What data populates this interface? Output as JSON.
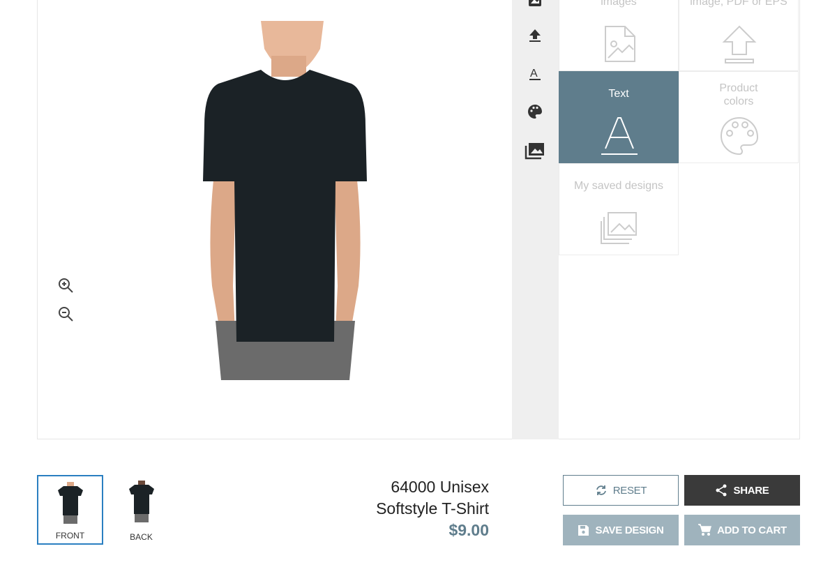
{
  "tiles": [
    {
      "label": "images",
      "icon": "image-file-icon"
    },
    {
      "label": "image, PDF or EPS",
      "icon": "upload-icon"
    },
    {
      "label": "Text",
      "icon": "text-icon",
      "active": true
    },
    {
      "label": "Product colors",
      "icon": "palette-icon"
    },
    {
      "label": "My saved designs",
      "icon": "saved-designs-icon"
    }
  ],
  "strip_icons": [
    "image-icon",
    "upload-icon",
    "text-icon",
    "palette-icon",
    "saved-designs-icon"
  ],
  "thumbs": [
    {
      "label": "FRONT",
      "selected": true
    },
    {
      "label": "BACK"
    }
  ],
  "product": {
    "name_line1": "64000 Unisex",
    "name_line2": "Softstyle T-Shirt",
    "price": "$9.00"
  },
  "buttons": {
    "reset": "RESET",
    "share": "SHARE",
    "save": "SAVE DESIGN",
    "cart": "ADD TO CART"
  },
  "colors": {
    "accent": "#5f7d8c",
    "dark": "#3a3a3a",
    "muted": "#9fb3bd",
    "select": "#2a7fc1"
  }
}
